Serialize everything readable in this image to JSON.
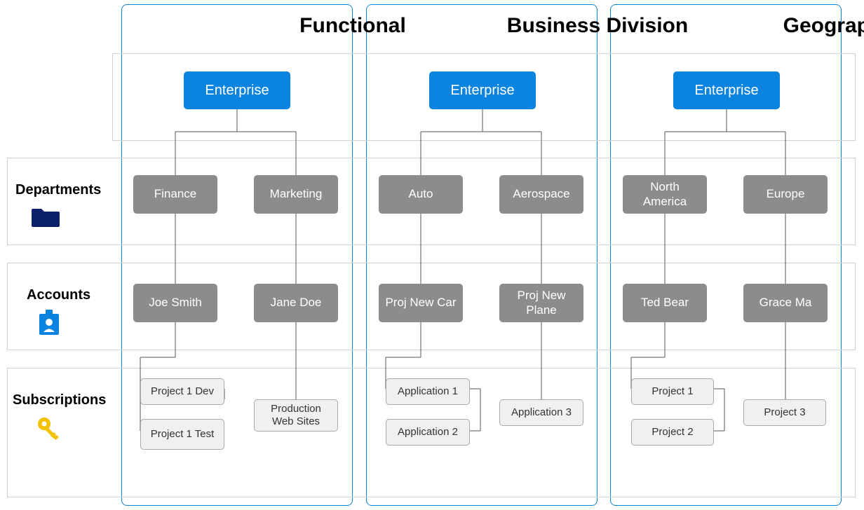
{
  "columns": [
    {
      "title": "Functional",
      "tree": {
        "enterprise": "Enterprise",
        "departments": [
          "Finance",
          "Marketing"
        ],
        "accounts": [
          "Joe Smith",
          "Jane Doe"
        ],
        "subscriptions": [
          [
            "Project 1 Dev",
            "Project 1 Test"
          ],
          [
            "Production Web Sites"
          ]
        ]
      }
    },
    {
      "title": "Business Division",
      "tree": {
        "enterprise": "Enterprise",
        "departments": [
          "Auto",
          "Aerospace"
        ],
        "accounts": [
          "Proj New Car",
          "Proj New Plane"
        ],
        "subscriptions": [
          [
            "Application 1",
            "Application 2"
          ],
          [
            "Application 3"
          ]
        ]
      }
    },
    {
      "title": "Geographic",
      "tree": {
        "enterprise": "Enterprise",
        "departments": [
          "North America",
          "Europe"
        ],
        "accounts": [
          "Ted Bear",
          "Grace Ma"
        ],
        "subscriptions": [
          [
            "Project 1",
            "Project 2"
          ],
          [
            "Project 3"
          ]
        ]
      }
    }
  ],
  "rowLabels": {
    "departments": "Departments",
    "accounts": "Accounts",
    "subscriptions": "Subscriptions"
  },
  "colors": {
    "enterprise": "#0b84e0",
    "department": "#8c8c8c",
    "account": "#8c8c8c",
    "subscription": "#f0f0f0",
    "columnBorder": "#0b84e0",
    "rowBorder": "#d0d0d0",
    "folderIcon": "#0b1f6b",
    "accountIcon": "#0b84e0",
    "keyIcon": "#f3c100"
  }
}
